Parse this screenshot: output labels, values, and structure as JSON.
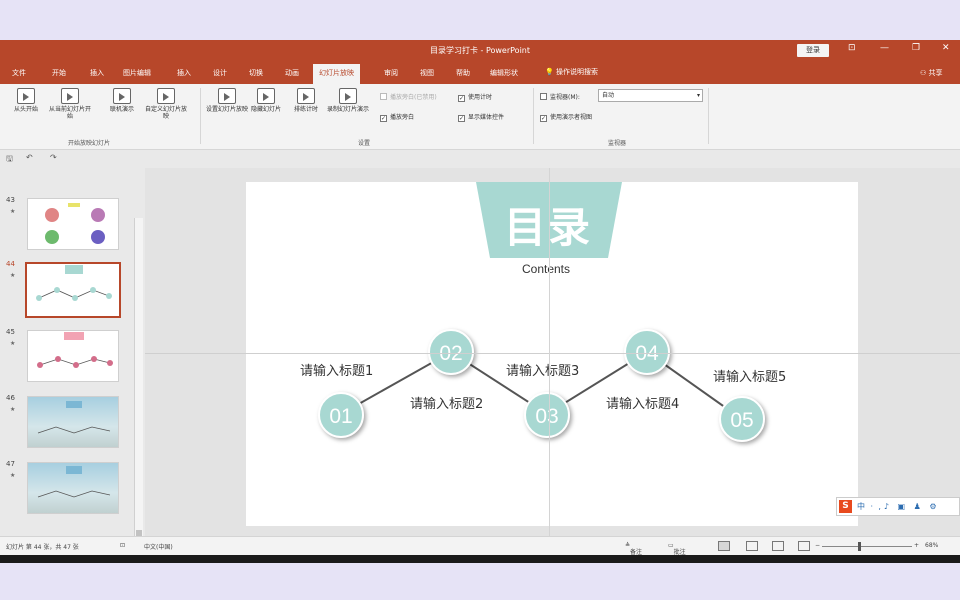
{
  "window": {
    "title": "目录学习打卡 - PowerPoint",
    "login_label": "登录",
    "win_controls": [
      "⊡",
      "—",
      "❐",
      "✕"
    ]
  },
  "tabs": [
    {
      "label": "文件"
    },
    {
      "label": "开始"
    },
    {
      "label": "插入"
    },
    {
      "label": "图片编辑"
    },
    {
      "label": "插入"
    },
    {
      "label": "设计"
    },
    {
      "label": "切换"
    },
    {
      "label": "动画"
    },
    {
      "label": "幻灯片放映",
      "active": true
    },
    {
      "label": "审阅"
    },
    {
      "label": "视图"
    },
    {
      "label": "帮助"
    },
    {
      "label": "编辑形状"
    }
  ],
  "tell_me": "操作说明搜索",
  "share": "共享",
  "ribbon": {
    "buttons": [
      {
        "label": "从头开始"
      },
      {
        "label": "从当前幻灯片开始"
      },
      {
        "label": "联机演示"
      },
      {
        "label": "自定义幻灯片放映"
      },
      {
        "label": "设置幻灯片放映"
      },
      {
        "label": "隐藏幻灯片"
      },
      {
        "label": "排练计时"
      },
      {
        "label": "录制幻灯片演示"
      }
    ],
    "group_labels": {
      "start": "开始放映幻灯片",
      "setup": "设置",
      "monitors": "监视器"
    },
    "checks": {
      "play_narrations": "播放旁白",
      "use_timings": "使用计时",
      "show_media_controls": "显示媒体控件",
      "play_narration_disabled": "播放旁白(已禁用)",
      "monitor_label": "监视器(M):",
      "use_presenter_view": "使用演示者视图"
    },
    "monitor_value": "自动"
  },
  "qat": {
    "save": "🖫",
    "undo": "↶",
    "redo": "↷"
  },
  "thumbnails": [
    {
      "num": "43",
      "star": "★"
    },
    {
      "num": "44",
      "star": "★"
    },
    {
      "num": "45",
      "star": "★"
    },
    {
      "num": "46",
      "star": "★"
    },
    {
      "num": "47",
      "star": "★"
    }
  ],
  "slide": {
    "title": "目录",
    "subtitle": "Contents",
    "accent_color": "#a8d8d2",
    "nodes": [
      "01",
      "02",
      "03",
      "04",
      "05"
    ],
    "labels": [
      "请输入标题1",
      "请输入标题2",
      "请输入标题3",
      "请输入标题4",
      "请输入标题5"
    ]
  },
  "ime": {
    "logo": "S",
    "items": "中ㆍ,♪ ▣ ♟ ⚙"
  },
  "status": {
    "slide_info": "幻灯片 第 44 张，共 47 张",
    "language": "中文(中国)",
    "notes": "备注",
    "comments": "批注",
    "zoom": "68%"
  }
}
